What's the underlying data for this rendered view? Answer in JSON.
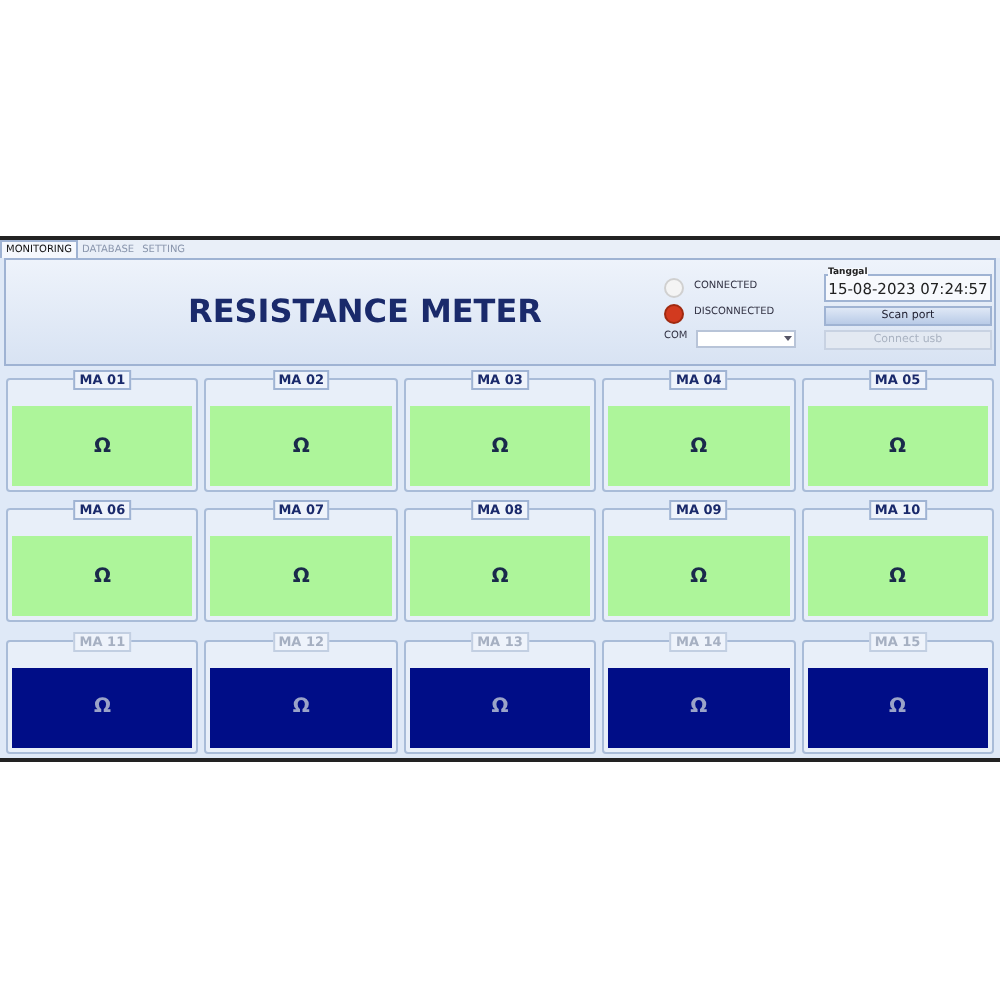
{
  "tabs": [
    {
      "label": "MONITORING",
      "selected": true
    },
    {
      "label": "DATABASE",
      "selected": false
    },
    {
      "label": "SETTING",
      "selected": false
    }
  ],
  "title": "RESISTANCE METER",
  "status": [
    {
      "label": "CONNECTED",
      "on": false
    },
    {
      "label": "DISCONNECTED",
      "on": true
    }
  ],
  "com": {
    "label": "COM"
  },
  "date": {
    "label": "Tanggal",
    "value": "15-08-2023 07:24:57"
  },
  "buttons": [
    {
      "label": "Scan port",
      "disabled": false
    },
    {
      "label": "Connect usb",
      "disabled": true
    }
  ],
  "meters": [
    {
      "label": "MA 01",
      "reading": "Ω",
      "disabled": false
    },
    {
      "label": "MA 02",
      "reading": "Ω",
      "disabled": false
    },
    {
      "label": "MA 03",
      "reading": "Ω",
      "disabled": false
    },
    {
      "label": "MA 04",
      "reading": "Ω",
      "disabled": false
    },
    {
      "label": "MA 05",
      "reading": "Ω",
      "disabled": false
    },
    {
      "label": "MA 06",
      "reading": "Ω",
      "disabled": false
    },
    {
      "label": "MA 07",
      "reading": "Ω",
      "disabled": false
    },
    {
      "label": "MA 08",
      "reading": "Ω",
      "disabled": false
    },
    {
      "label": "MA 09",
      "reading": "Ω",
      "disabled": false
    },
    {
      "label": "MA 10",
      "reading": "Ω",
      "disabled": false
    },
    {
      "label": "MA 11",
      "reading": "Ω",
      "disabled": true
    },
    {
      "label": "MA 12",
      "reading": "Ω",
      "disabled": true
    },
    {
      "label": "MA 13",
      "reading": "Ω",
      "disabled": true
    },
    {
      "label": "MA 14",
      "reading": "Ω",
      "disabled": true
    },
    {
      "label": "MA 15",
      "reading": "Ω",
      "disabled": true
    }
  ]
}
